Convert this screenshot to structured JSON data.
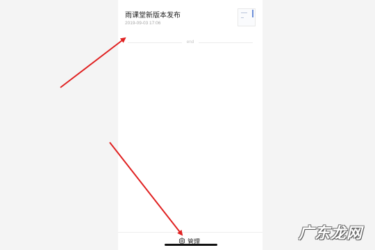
{
  "article": {
    "title": "雨课堂新版本发布",
    "date": "2019-09-03 17:06"
  },
  "feed": {
    "end_text": "end"
  },
  "bottom_bar": {
    "manage_label": "管理",
    "manage_icon": "gear-icon"
  },
  "annotation": {
    "arrow_color": "#e02020"
  },
  "watermark": {
    "text": "广东龙网"
  }
}
